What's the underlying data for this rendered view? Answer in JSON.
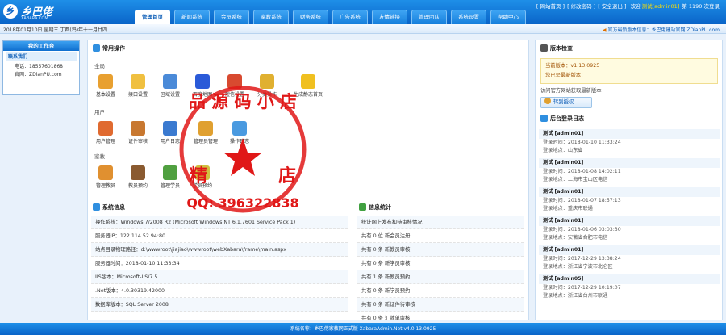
{
  "header": {
    "logo_icon": "乡",
    "logo_text": "乡巴佬",
    "logo_sub": "XABARA.COM",
    "links": [
      "[ 网站首页 ]",
      "[ 修改密码 ]",
      "[ 安全退出 ]"
    ],
    "welcome_prefix": "欢迎",
    "user": "测试[admin01]",
    "visits": "第 1190 次登录"
  },
  "nav": {
    "tabs": [
      "管理首页",
      "新闻系统",
      "会员系统",
      "家教系统",
      "财务系统",
      "广告系统",
      "友情链接",
      "管理团队",
      "系统设置",
      "帮助中心"
    ],
    "active_index": 0
  },
  "datebar": {
    "date": "2018年01月10日 星期三 丁酉(鸡)年十一月廿四",
    "notice": "官方最新版本信息：乡巴佬建站官网 ZDianPU.com"
  },
  "sidebar": {
    "title": "我的工作台",
    "section": "联系我们",
    "phone": "电话：18557601868",
    "site": "官网：ZDianPU.com"
  },
  "common": {
    "title": "常用操作",
    "groups": [
      {
        "name": "全局",
        "items": [
          "基本设置",
          "接口设置",
          "区域设置",
          "百度地图",
          "短信设置",
          "分类操作",
          "生成静态首页"
        ]
      },
      {
        "name": "用户",
        "items": [
          "用户管理",
          "证件审核",
          "用户日志",
          "管理员管理",
          "操作日志"
        ]
      },
      {
        "name": "家教",
        "items": [
          "管理教员",
          "教员预约",
          "管理学员",
          "学员预约"
        ]
      }
    ]
  },
  "sysinfo": {
    "title": "系统信息",
    "rows": [
      "操作系统：Windows 7/2008 R2 (Microsoft Windows NT 6.1.7601 Service Pack 1)",
      "服务器IP：122.114.52.94:80",
      "站点目录物理路径：d:\\wwwroot\\jiajiao\\wwwroot\\webXabara\\frame\\main.aspx",
      "服务器时间：2018-01-10 11:33:34",
      "IIS版本：Microsoft-IIS/7.5",
      ".Net版本：4.0.30319.42000",
      "数据库版本：SQL Server 2008"
    ]
  },
  "stats": {
    "title": "信息统计",
    "rows": [
      "统计网上发布和待审核情况",
      "共有 0 位 新会员注册",
      "共有 0 条 新教员审核",
      "共有 0 条 新学员审核",
      "共有 1 条 新教员预约",
      "共有 0 条 新学员预约",
      "共有 0 条 新证件待审核",
      "共有 0 条 汇款单审核"
    ]
  },
  "version": {
    "title": "版本检查",
    "current": "当前版本：v1.13.0925",
    "status": "您已是最新版本！",
    "official": "访问官方网站获取最新版本",
    "button": "转到授权"
  },
  "logs": {
    "title": "后台登录日志",
    "entries": [
      {
        "user": "测试 [admin01]",
        "time": "登录时间：2018-01-10 11:33:24",
        "place": "登录地点：山东省"
      },
      {
        "user": "测试 [admin01]",
        "time": "登录时间：2018-01-08 14:02:11",
        "place": "登录地点：上海市宝山区电信"
      },
      {
        "user": "测试 [admin01]",
        "time": "登录时间：2018-01-07 18:57:13",
        "place": "登录地点：重庆市联通"
      },
      {
        "user": "测试 [admin01]",
        "time": "登录时间：2018-01-06 03:03:30",
        "place": "登录地点：安徽省合肥市电信"
      },
      {
        "user": "测试 [admin01]",
        "time": "登录时间：2017-12-29 13:38:24",
        "place": "登录地点：浙江省宁波市北仑区"
      },
      {
        "user": "测试 [admin05]",
        "time": "登录时间：2017-12-29 10:19:07",
        "place": "登录地点：浙江省台州市联通"
      }
    ]
  },
  "footer": {
    "text": "系统名称：乡巴佬家教网正式版 XabaraAdmin.Net v4.0.13.0925"
  },
  "watermark": {
    "top_text": "品 源 码 小 店",
    "left_char": "精",
    "right_char": "店",
    "qq": "QQ: 396322838",
    "color": "#e01818"
  },
  "colors": {
    "accent": "#0a64c8",
    "stamp": "#e01818"
  }
}
